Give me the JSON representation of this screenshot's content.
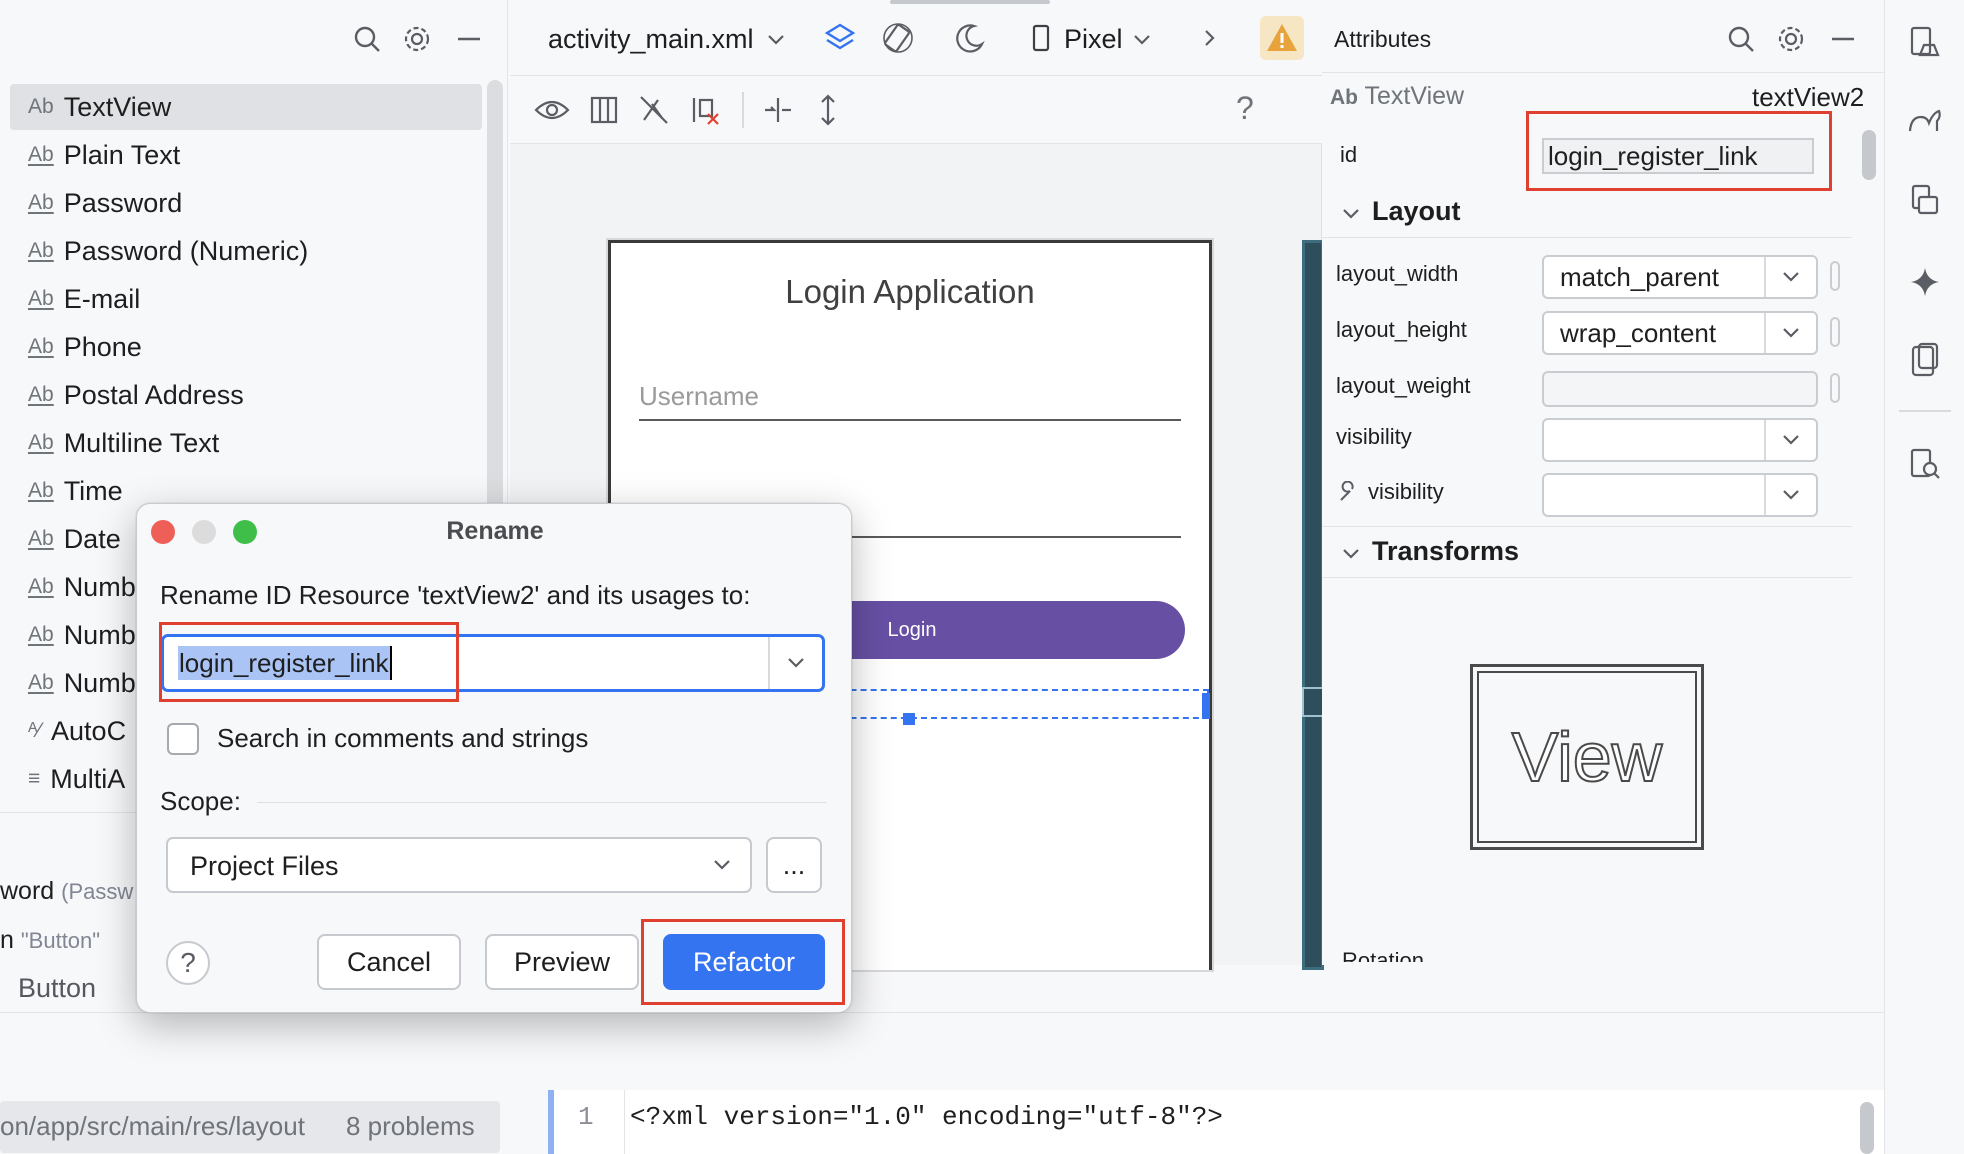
{
  "palette": {
    "items": [
      {
        "badge": "Ab",
        "label": "TextView",
        "selected": true
      },
      {
        "badge": "Ab",
        "label": "Plain Text"
      },
      {
        "badge": "Ab",
        "label": "Password"
      },
      {
        "badge": "Ab",
        "label": "Password (Numeric)"
      },
      {
        "badge": "Ab",
        "label": "E-mail"
      },
      {
        "badge": "Ab",
        "label": "Phone"
      },
      {
        "badge": "Ab",
        "label": "Postal Address"
      },
      {
        "badge": "Ab",
        "label": "Multiline Text"
      },
      {
        "badge": "Ab",
        "label": "Time"
      },
      {
        "badge": "Ab",
        "label": "Date"
      },
      {
        "badge": "Ab",
        "label": "Numb"
      },
      {
        "badge": "Ab",
        "label": "Numb"
      },
      {
        "badge": "Ab",
        "label": "Numb"
      },
      {
        "badge": "",
        "label": "AutoC"
      },
      {
        "badge": "",
        "label": "MultiA"
      }
    ]
  },
  "tree": {
    "row1_name": "word",
    "row1_type": "(Passw",
    "row2_name": "n",
    "row2_type": "\"Button\"",
    "row3": "Button"
  },
  "editor": {
    "file_name": "activity_main.xml",
    "device": "Pixel",
    "help": "?"
  },
  "phone": {
    "title": "Login Application",
    "username_hint": "Username",
    "login_button": "Login"
  },
  "attributes": {
    "header": "Attributes",
    "widget_badge": "Ab",
    "widget_type": "TextView",
    "widget_id": "textView2",
    "id_label": "id",
    "id_value": "login_register_link",
    "layout_section": "Layout",
    "rows": [
      {
        "label": "layout_width",
        "value": "match_parent"
      },
      {
        "label": "layout_height",
        "value": "wrap_content"
      },
      {
        "label": "layout_weight",
        "value": ""
      },
      {
        "label": "visibility",
        "value": ""
      },
      {
        "label": "visibility",
        "value": ""
      }
    ],
    "transforms_section": "Transforms",
    "view_preview": "View",
    "rotation_label": "Rotation"
  },
  "dialog": {
    "title": "Rename",
    "prompt": "Rename ID Resource 'textView2' and its usages to:",
    "new_name": "login_register_link",
    "search_in_comments": "Search in comments and strings",
    "search_checked": false,
    "scope_label": "Scope:",
    "scope_value": "Project Files",
    "more_button": "...",
    "help_button": "?",
    "cancel": "Cancel",
    "preview": "Preview",
    "refactor": "Refactor"
  },
  "status": {
    "path": "on/app/src/main/res/layout",
    "problems": "8 problems"
  },
  "code": {
    "line_number": "1",
    "line1": "<?xml version=\"1.0\" encoding=\"utf-8\"?>"
  },
  "colors": {
    "accent": "#3574f0",
    "highlight_box": "#e0402f",
    "login_button": "#6750a4",
    "warning": "#e8a33c"
  }
}
